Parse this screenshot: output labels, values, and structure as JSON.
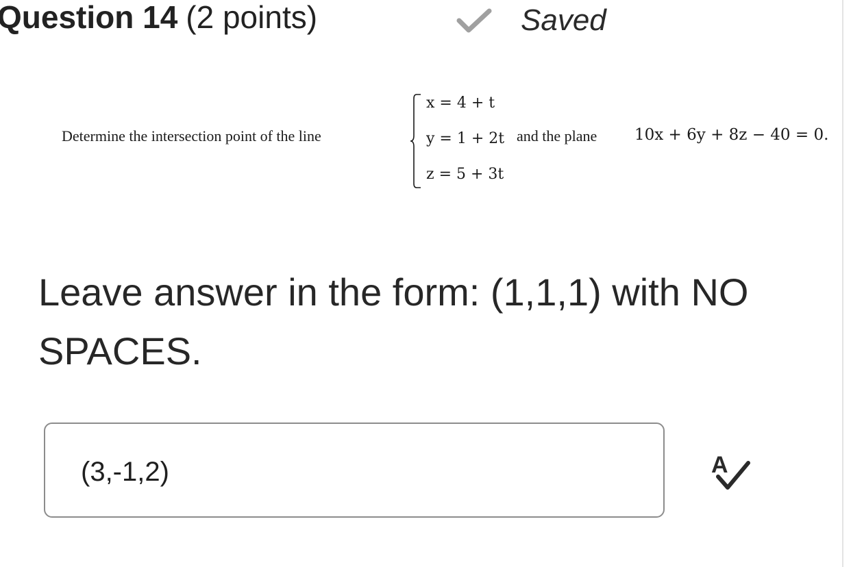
{
  "header": {
    "question_title": "Question 14",
    "points": "(2 points)",
    "saved_icon": "checkmark-icon",
    "saved_label": "Saved"
  },
  "problem": {
    "lead_text": "Determine the intersection point of the line",
    "equations": [
      "x = 4 + t",
      "y = 1 + 2t",
      "z = 5 + 3t"
    ],
    "connector_text": "and the plane",
    "plane_equation": "10x + 6y + 8z − 40 = 0."
  },
  "instruction": {
    "text": "Leave answer in the form: (1,1,1) with NO SPACES."
  },
  "answer": {
    "value": "(3,-1,2)",
    "placeholder": ""
  },
  "tools": {
    "spellcheck_icon": "spellcheck-icon"
  },
  "colors": {
    "check_gray": "#a0a0a0",
    "border_gray": "#8c8c8c",
    "text_dark": "#222222"
  }
}
